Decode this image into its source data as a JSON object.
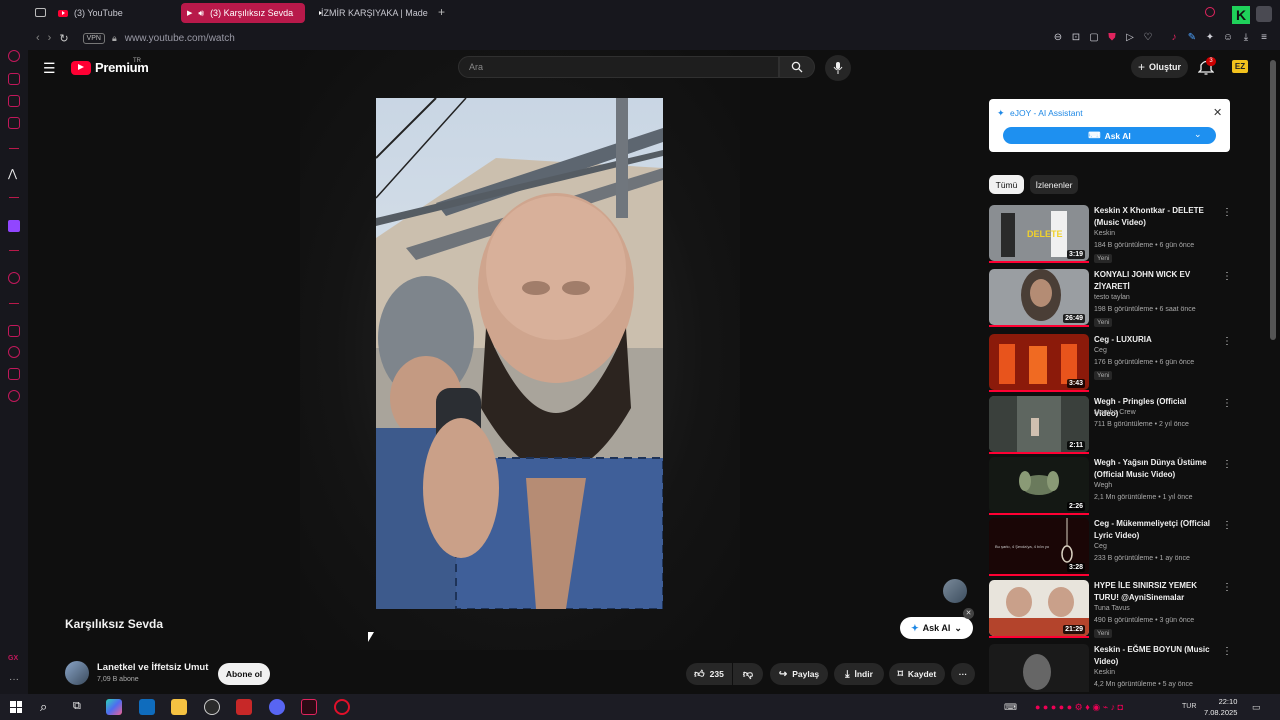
{
  "browser": {
    "tabs": [
      {
        "label": "(3) YouTube",
        "active": false
      },
      {
        "label": "(3) Karşılıksız Sevda",
        "active": true
      },
      {
        "label": "İZMİR KARŞIYAKA | Made",
        "active": false
      }
    ],
    "new_tab": "+",
    "vpn": "VPN",
    "url": "www.youtube.com/watch"
  },
  "youtube": {
    "logo_text": "Premium",
    "logo_region": "TR",
    "search_placeholder": "Ara",
    "create_label": "Oluştur",
    "notification_count": "3",
    "avatar_text": "EZ"
  },
  "video": {
    "title": "Karşılıksız Sevda",
    "channel": "Lanetkel ve İffetsiz Umut",
    "subscribers": "7,09 B abone",
    "subscribe_label": "Abone ol",
    "likes": "235",
    "share_label": "Paylaş",
    "download_label": "İndir",
    "save_label": "Kaydet"
  },
  "ejoy": {
    "title": "eJOY - AI Assistant",
    "ask_label": "Ask AI",
    "float_label": "Ask AI"
  },
  "filters": [
    "Tümü",
    "İzlenenler"
  ],
  "recommendations": [
    {
      "title": "Keskin X Khontkar - DELETE (Music Video)",
      "channel": "Keskin",
      "meta": "184 B görüntüleme • 6 gün önce",
      "new": "Yeni",
      "duration": "3:19"
    },
    {
      "title": "KONYALI JOHN WICK EV ZİYARETİ",
      "channel": "testo taylan",
      "meta": "198 B görüntüleme • 6 saat önce",
      "new": "Yeni",
      "duration": "26:49"
    },
    {
      "title": "Ceg - LUXURIA",
      "channel": "Ceg",
      "meta": "176 B görüntüleme • 6 gün önce",
      "new": "Yeni",
      "duration": "3:43"
    },
    {
      "title": "Wegh - Pringles (Official Video)",
      "channel": "Mamba Crew",
      "meta": "711 B görüntüleme • 2 yıl önce",
      "new": "",
      "duration": "2:11"
    },
    {
      "title": "Wegh - Yağsın Dünya Üstüme (Official Music Video)",
      "channel": "Wegh",
      "meta": "2,1 Mn görüntüleme • 1 yıl önce",
      "new": "",
      "duration": "2:26"
    },
    {
      "title": "Ceg - Mükemmeliyetçi (Official Lyric Video)",
      "channel": "Ceg",
      "meta": "233 B görüntüleme • 1 ay önce",
      "new": "",
      "duration": "3:28"
    },
    {
      "title": "HYPE İLE SINIRSIZ YEMEK TURU! @AyniSinemalar",
      "channel": "Tuna Tavus",
      "meta": "490 B görüntüleme • 3 gün önce",
      "new": "Yeni",
      "duration": "21:29"
    },
    {
      "title": "Keskin - EĞME BOYUN (Music Video)",
      "channel": "Keskin",
      "meta": "4,2 Mn görüntüleme • 5 ay önce",
      "new": "",
      "duration": ""
    }
  ],
  "thumb_texts": {
    "delete": "DELETE",
    "lyric": "Bu şarkı, 4 Şevda'ya, 4 bön yo"
  },
  "taskbar": {
    "lang": "TUR",
    "time": "22:10",
    "date": "7.08.2025",
    "side_label": "GX"
  },
  "colors": {
    "accent": "#ff0033",
    "opera_red": "#b8194a",
    "ejoy_blue": "#1e90f0"
  }
}
